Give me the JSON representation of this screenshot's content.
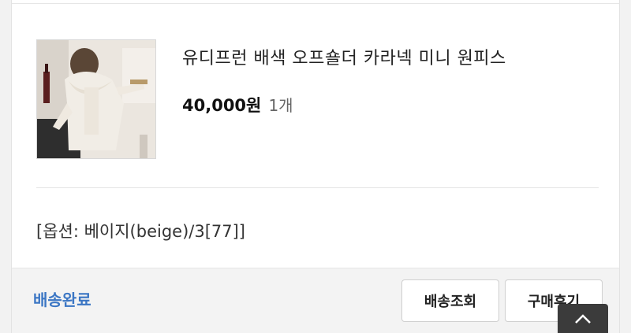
{
  "order_item": {
    "product_name": "유디프런 배색 오프숄더 카라넥 미니 원피스",
    "price": "40,000원",
    "quantity": "1개",
    "option": "[옵션: 베이지(beige)/3[77]]",
    "thumbnail_icon": "product-photo-dress"
  },
  "footer": {
    "status": "배송완료",
    "track_button": "배송조회",
    "review_button": "구매후기",
    "scroll_top_icon": "chevron-up-icon"
  },
  "colors": {
    "status_blue": "#3b76c4",
    "scroll_top_bg": "#3b3b3b"
  }
}
